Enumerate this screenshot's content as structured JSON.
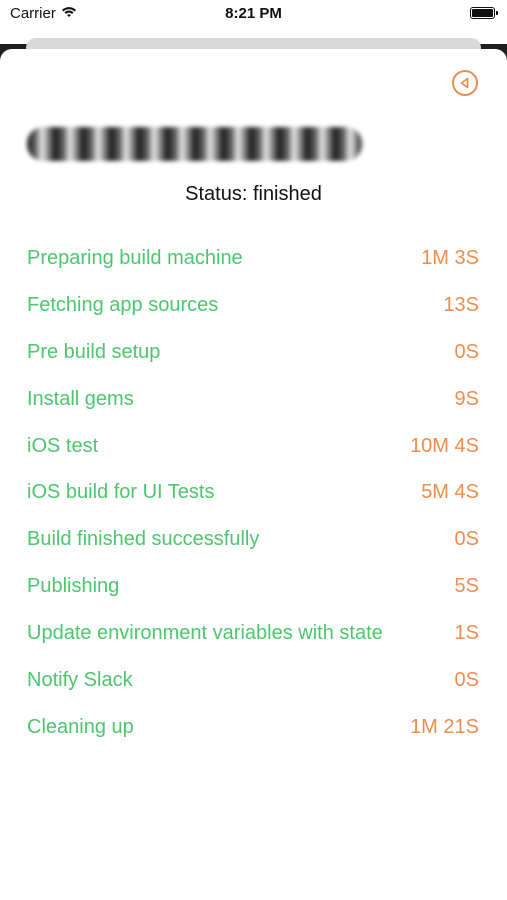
{
  "status_bar": {
    "carrier": "Carrier",
    "time": "8:21 PM"
  },
  "header": {
    "status": "Status: finished"
  },
  "steps": [
    {
      "name": "Preparing build machine",
      "time": "1M 3S"
    },
    {
      "name": "Fetching app sources",
      "time": "13S"
    },
    {
      "name": "Pre build setup",
      "time": "0S"
    },
    {
      "name": "Install gems",
      "time": "9S"
    },
    {
      "name": "iOS test",
      "time": "10M 4S"
    },
    {
      "name": "iOS build for UI Tests",
      "time": "5M 4S"
    },
    {
      "name": "Build finished successfully",
      "time": "0S"
    },
    {
      "name": "Publishing",
      "time": "5S"
    },
    {
      "name": "Update environment variables with state",
      "time": "1S"
    },
    {
      "name": "Notify Slack",
      "time": "0S"
    },
    {
      "name": "Cleaning up",
      "time": "1M 21S"
    }
  ],
  "colors": {
    "step_name": "#4cc76e",
    "step_time": "#ef8d4e",
    "accent": "#ef8d4e"
  },
  "icons": {
    "back": "back-icon",
    "wifi": "wifi-icon",
    "battery": "battery-icon"
  }
}
